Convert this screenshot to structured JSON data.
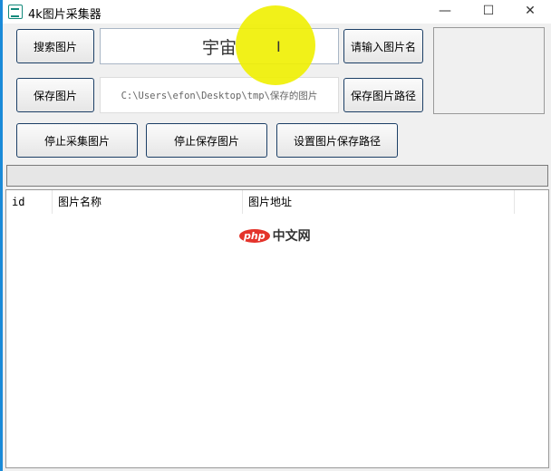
{
  "window": {
    "title": "4k图片采集器",
    "minimize": "—",
    "maximize": "☐",
    "close": "✕"
  },
  "search": {
    "button": "搜索图片",
    "value": "宇宙",
    "hint_button": "请输入图片名"
  },
  "save": {
    "button": "保存图片",
    "path": "C:\\Users\\efon\\Desktop\\tmp\\保存的图片",
    "path_button": "保存图片路径"
  },
  "actions": {
    "stop_collect": "停止采集图片",
    "stop_save": "停止保存图片",
    "set_path": "设置图片保存路径"
  },
  "progress": {
    "value": 0
  },
  "table": {
    "columns": [
      "id",
      "图片名称",
      "图片地址"
    ],
    "rows": []
  },
  "watermark": {
    "logo": "php",
    "text": "中文网"
  }
}
